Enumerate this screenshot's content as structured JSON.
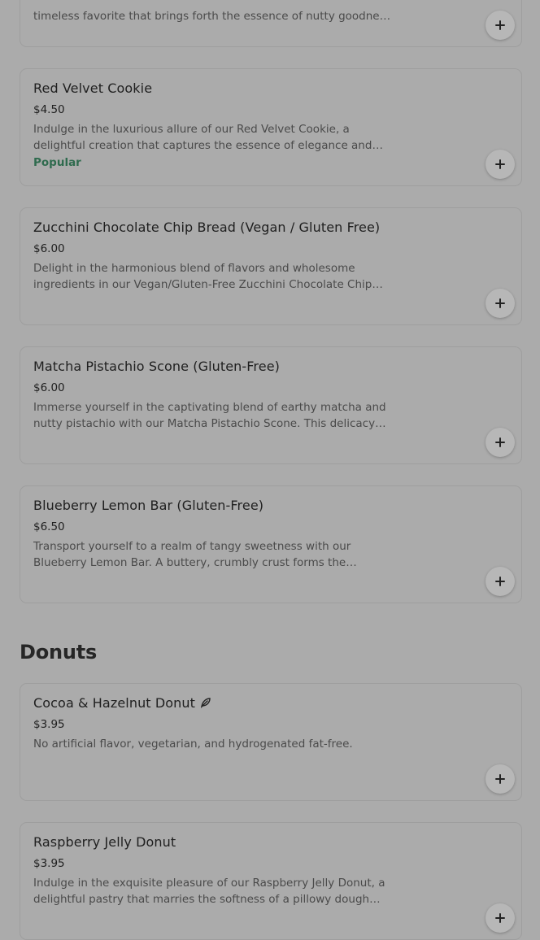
{
  "sections": [
    {
      "items": [
        {
          "description": "timeless favorite that brings forth the essence of nutty goodness and more."
        },
        {
          "name": "Red Velvet Cookie",
          "price": "$4.50",
          "description": "Indulge in the luxurious allure of our Red Velvet Cookie, a delightful creation that captures the essence of elegance and decadence. This ...",
          "badge": "Popular"
        },
        {
          "name": "Zucchini Chocolate Chip Bread (Vegan / Gluten Free)",
          "price": "$6.00",
          "description": "Delight in the harmonious blend of flavors and wholesome ingredients in our Vegan/Gluten-Free Zucchini Chocolate Chip Bread..."
        },
        {
          "name": "Matcha Pistachio Scone (Gluten-Free)",
          "price": "$6.00",
          "description": "Immerse yourself in the captivating blend of earthy matcha and nutty pistachio with our Matcha Pistachio Scone. This delicacy offers..."
        },
        {
          "name": "Blueberry Lemon Bar (Gluten-Free)",
          "price": "$6.50",
          "description": "Transport yourself to a realm of tangy sweetness with our Blueberry Lemon Bar. A buttery, crumbly crust forms the foundation for this..."
        }
      ]
    },
    {
      "title": "Donuts",
      "items": [
        {
          "name": "Cocoa & Hazelnut Donut",
          "icon": "leaf-icon",
          "price": "$3.95",
          "description": "No artificial flavor, vegetarian, and hydrogenated fat-free."
        },
        {
          "name": "Raspberry Jelly Donut",
          "price": "$3.95",
          "description": "Indulge in the exquisite pleasure of our Raspberry Jelly Donut, a delightful pastry that marries the softness of a pillowy dough with..."
        }
      ]
    }
  ],
  "add_icon": "plus-icon",
  "colors": {
    "background": "#ababab",
    "badge": "#2f6b4e",
    "text": "#202020",
    "muted_text": "#4a4a4a"
  }
}
